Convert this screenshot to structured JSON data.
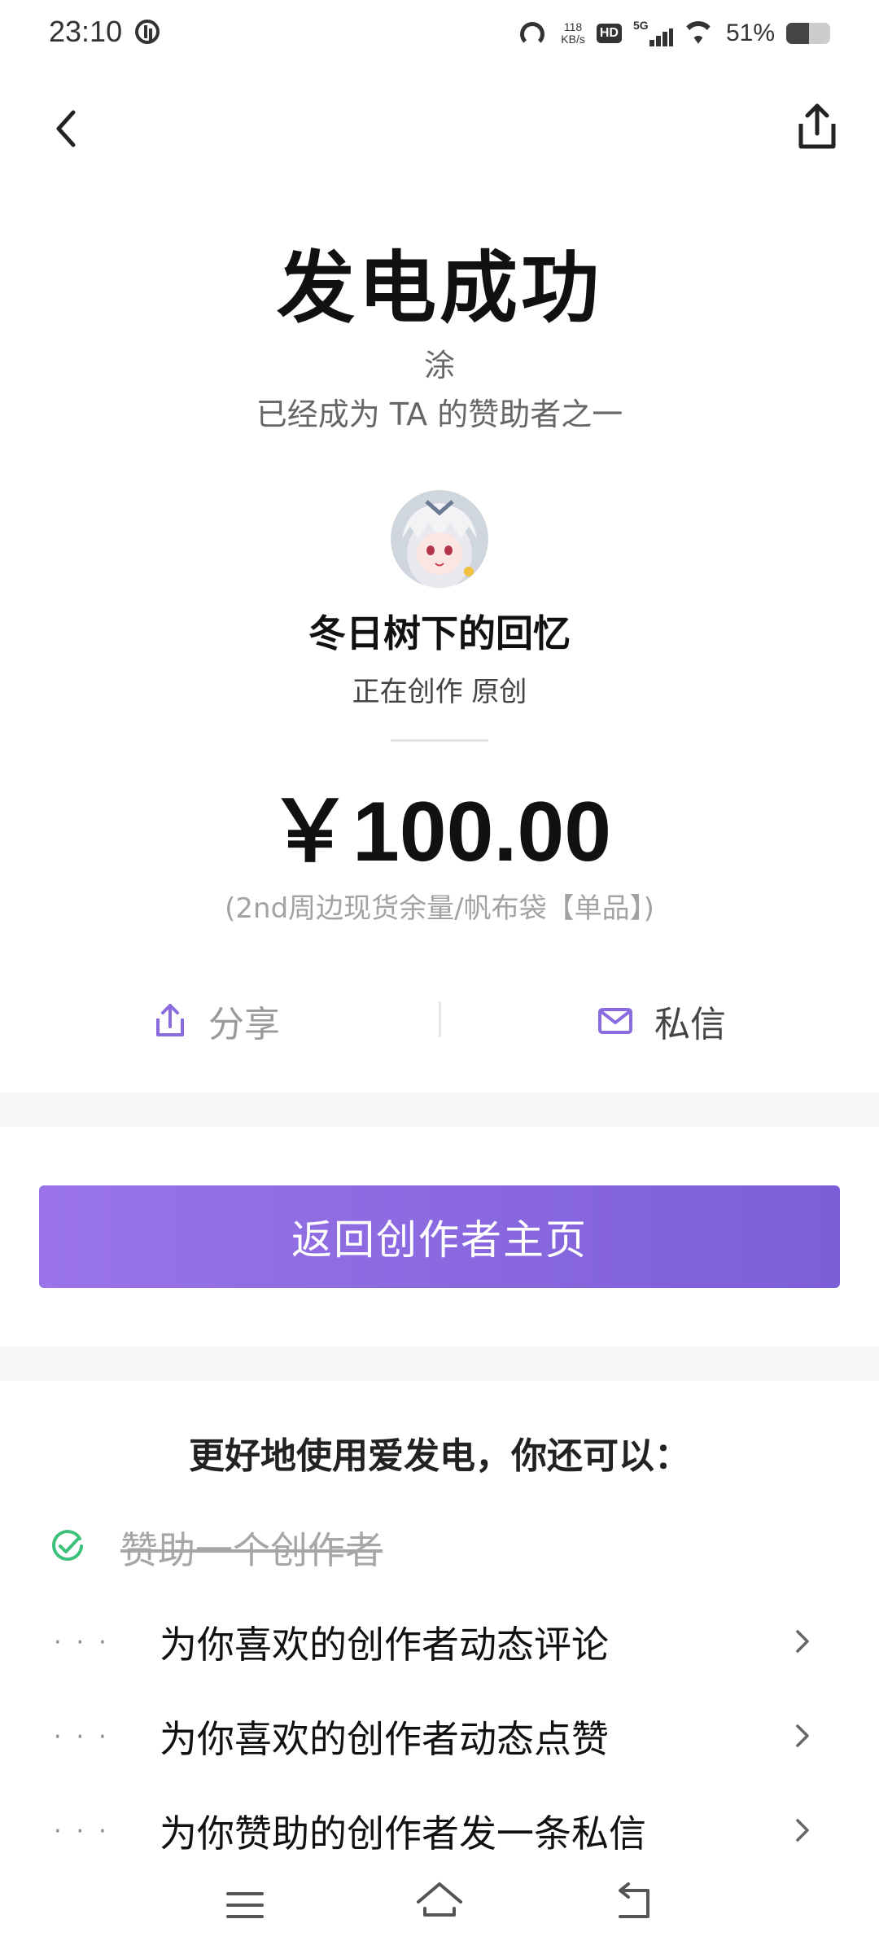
{
  "status_bar": {
    "time": "23:10",
    "net_speed_value": "118",
    "net_speed_unit": "KB/s",
    "hd_label": "HD",
    "network_label": "5G",
    "battery_text": "51%",
    "battery_level": 0.51
  },
  "hero": {
    "title": "发电成功",
    "supporter_name": "涂",
    "supporter_status": "已经成为 TA 的赞助者之一",
    "creator_name": "冬日树下的回忆",
    "creator_desc": "正在创作 原创",
    "amount": "￥100.00",
    "item_note": "(2nd周边现货余量/帆布袋【单品】)"
  },
  "actions": {
    "share_label": "分享",
    "message_label": "私信"
  },
  "cta": {
    "label": "返回创作者主页"
  },
  "tips": {
    "title": "更好地使用爱发电，你还可以：",
    "done_task": "赞助一个创作者",
    "tasks": [
      {
        "label": "为你喜欢的创作者动态评论",
        "dots": "···"
      },
      {
        "label": "为你喜欢的创作者动态点赞",
        "dots": "···"
      },
      {
        "label": "为你赞助的创作者发一条私信",
        "dots": "···"
      }
    ]
  },
  "icons": {
    "back": "chevron-left-icon",
    "share_top": "share-icon",
    "share_action": "share-icon",
    "message": "mail-icon",
    "done": "check-circle-icon",
    "chevron": "chevron-right-icon",
    "nav_menu": "menu-icon",
    "nav_home": "home-icon",
    "nav_back": "back-icon"
  },
  "colors": {
    "accent": "#8a6be0",
    "accent_end": "#7c5ed8",
    "success": "#3cc07a",
    "muted_text": "#a2a2a2"
  }
}
